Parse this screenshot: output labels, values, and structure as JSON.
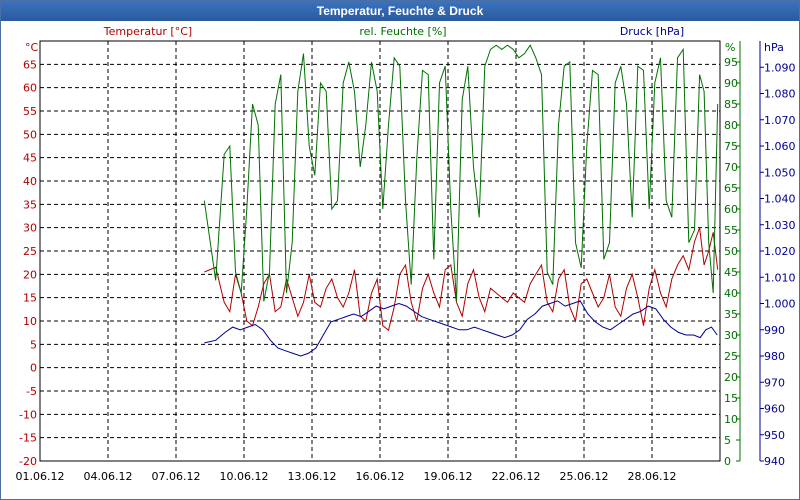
{
  "window": {
    "title": "Temperatur, Feuchte & Druck"
  },
  "chart_data": {
    "type": "line",
    "x_ticks": [
      "01.06.12",
      "04.06.12",
      "07.06.12",
      "10.06.12",
      "13.06.12",
      "16.06.12",
      "19.06.12",
      "22.06.12",
      "25.06.12",
      "28.06.12"
    ],
    "xlim": [
      "01.06.12",
      "01.07.12"
    ],
    "grid": true,
    "axes": {
      "temperature": {
        "label": "Temperatur [°C]",
        "unit": "°C",
        "ylim": [
          -20,
          70
        ],
        "ticks": [
          -20,
          -15,
          -10,
          -5,
          0,
          5,
          10,
          15,
          20,
          25,
          30,
          35,
          40,
          45,
          50,
          55,
          60,
          65
        ],
        "color": "#b00000"
      },
      "humidity": {
        "label": "rel. Feuchte [%]",
        "unit": "%",
        "ylim": [
          0,
          100
        ],
        "ticks": [
          0,
          5,
          10,
          15,
          20,
          25,
          30,
          35,
          40,
          45,
          50,
          55,
          60,
          65,
          70,
          75,
          80,
          85,
          90,
          95
        ],
        "color": "#007000"
      },
      "pressure": {
        "label": "Druck [hPa]",
        "unit": "hPa",
        "ylim": [
          940,
          1100
        ],
        "ticks": [
          "940",
          "950",
          "960",
          "970",
          "980",
          "990",
          "1.000",
          "1.010",
          "1.020",
          "1.030",
          "1.040",
          "1.050",
          "1.060",
          "1.070",
          "1.080",
          "1.090"
        ],
        "color": "#000090"
      }
    },
    "series": [
      {
        "name": "Temperatur [°C]",
        "axis": "temperature",
        "color": "#b00000",
        "x": [
          "08.06.12",
          "08.06.12",
          "09.06.12",
          "09.06.12",
          "09.06.12",
          "09.06.12",
          "10.06.12",
          "10.06.12",
          "10.06.12",
          "10.06.12",
          "11.06.12",
          "11.06.12",
          "11.06.12",
          "11.06.12",
          "12.06.12",
          "12.06.12",
          "12.06.12",
          "12.06.12",
          "13.06.12",
          "13.06.12",
          "13.06.12",
          "13.06.12",
          "14.06.12",
          "14.06.12",
          "14.06.12",
          "14.06.12",
          "15.06.12",
          "15.06.12",
          "15.06.12",
          "15.06.12",
          "16.06.12",
          "16.06.12",
          "16.06.12",
          "16.06.12",
          "17.06.12",
          "17.06.12",
          "17.06.12",
          "17.06.12",
          "18.06.12",
          "18.06.12",
          "18.06.12",
          "18.06.12",
          "19.06.12",
          "19.06.12",
          "19.06.12",
          "19.06.12",
          "20.06.12",
          "20.06.12",
          "20.06.12",
          "20.06.12",
          "21.06.12",
          "21.06.12",
          "21.06.12",
          "21.06.12",
          "22.06.12",
          "22.06.12",
          "22.06.12",
          "22.06.12",
          "23.06.12",
          "23.06.12",
          "23.06.12",
          "23.06.12",
          "24.06.12",
          "24.06.12",
          "24.06.12",
          "24.06.12",
          "25.06.12",
          "25.06.12",
          "25.06.12",
          "25.06.12",
          "26.06.12",
          "26.06.12",
          "26.06.12",
          "26.06.12",
          "27.06.12",
          "27.06.12",
          "27.06.12",
          "27.06.12",
          "28.06.12",
          "28.06.12",
          "28.06.12",
          "28.06.12",
          "29.06.12",
          "29.06.12",
          "29.06.12",
          "29.06.12",
          "30.06.12",
          "30.06.12",
          "30.06.12",
          "30.06.12",
          "30.06.12"
        ],
        "y": [
          20.5,
          21.5,
          14,
          12,
          20,
          16,
          10,
          9,
          13,
          18,
          20,
          12,
          13,
          19,
          15,
          11,
          14,
          20,
          14,
          13,
          17,
          19,
          15,
          13,
          16,
          21,
          11,
          10,
          16,
          19,
          9,
          8,
          13,
          20,
          22,
          14,
          10,
          17,
          20,
          16,
          13,
          21,
          22,
          14,
          11,
          18,
          21,
          15,
          12,
          17,
          16,
          15,
          14,
          16,
          15,
          14,
          18,
          20,
          22,
          14,
          12,
          19,
          21,
          13,
          10,
          18,
          19,
          16,
          13,
          15,
          20,
          13,
          11,
          17,
          20,
          15,
          9,
          17,
          21,
          16,
          13,
          19,
          22,
          24,
          21,
          27,
          30,
          22,
          25,
          29,
          21
        ]
      },
      {
        "name": "rel. Feuchte [%]",
        "axis": "humidity",
        "color": "#007000",
        "x": [
          "08.06.12",
          "08.06.12",
          "09.06.12",
          "09.06.12",
          "09.06.12",
          "09.06.12",
          "10.06.12",
          "10.06.12",
          "10.06.12",
          "10.06.12",
          "11.06.12",
          "11.06.12",
          "11.06.12",
          "11.06.12",
          "12.06.12",
          "12.06.12",
          "12.06.12",
          "12.06.12",
          "13.06.12",
          "13.06.12",
          "13.06.12",
          "13.06.12",
          "14.06.12",
          "14.06.12",
          "14.06.12",
          "14.06.12",
          "15.06.12",
          "15.06.12",
          "15.06.12",
          "15.06.12",
          "16.06.12",
          "16.06.12",
          "16.06.12",
          "16.06.12",
          "17.06.12",
          "17.06.12",
          "17.06.12",
          "17.06.12",
          "18.06.12",
          "18.06.12",
          "18.06.12",
          "18.06.12",
          "19.06.12",
          "19.06.12",
          "19.06.12",
          "19.06.12",
          "20.06.12",
          "20.06.12",
          "20.06.12",
          "20.06.12",
          "21.06.12",
          "21.06.12",
          "21.06.12",
          "21.06.12",
          "22.06.12",
          "22.06.12",
          "22.06.12",
          "22.06.12",
          "23.06.12",
          "23.06.12",
          "23.06.12",
          "23.06.12",
          "24.06.12",
          "24.06.12",
          "24.06.12",
          "24.06.12",
          "25.06.12",
          "25.06.12",
          "25.06.12",
          "25.06.12",
          "26.06.12",
          "26.06.12",
          "26.06.12",
          "26.06.12",
          "27.06.12",
          "27.06.12",
          "27.06.12",
          "27.06.12",
          "28.06.12",
          "28.06.12",
          "28.06.12",
          "28.06.12",
          "29.06.12",
          "29.06.12",
          "29.06.12",
          "29.06.12",
          "30.06.12",
          "30.06.12",
          "30.06.12",
          "30.06.12",
          "30.06.12"
        ],
        "y": [
          62,
          43,
          73,
          75,
          45,
          40,
          60,
          85,
          80,
          38,
          45,
          85,
          92,
          40,
          52,
          88,
          97,
          75,
          68,
          90,
          88,
          60,
          62,
          90,
          95,
          88,
          70,
          80,
          95,
          88,
          60,
          80,
          96,
          94,
          62,
          42,
          72,
          93,
          92,
          48,
          90,
          94,
          60,
          38,
          86,
          94,
          70,
          58,
          94,
          98,
          99,
          98,
          99,
          98,
          96,
          97,
          99,
          96,
          92,
          45,
          42,
          80,
          94,
          95,
          52,
          46,
          75,
          93,
          92,
          48,
          52,
          90,
          94,
          85,
          58,
          94,
          93,
          60,
          90,
          96,
          62,
          58,
          96,
          98,
          52,
          55,
          92,
          88,
          52,
          40,
          85
        ]
      },
      {
        "name": "Druck [hPa]",
        "axis": "pressure",
        "color": "#000090",
        "x": [
          "08.06.12",
          "08.06.12",
          "09.06.12",
          "09.06.12",
          "09.06.12",
          "10.06.12",
          "10.06.12",
          "10.06.12",
          "11.06.12",
          "11.06.12",
          "11.06.12",
          "12.06.12",
          "12.06.12",
          "12.06.12",
          "13.06.12",
          "13.06.12",
          "13.06.12",
          "14.06.12",
          "14.06.12",
          "14.06.12",
          "15.06.12",
          "15.06.12",
          "15.06.12",
          "16.06.12",
          "16.06.12",
          "16.06.12",
          "17.06.12",
          "17.06.12",
          "17.06.12",
          "18.06.12",
          "18.06.12",
          "18.06.12",
          "19.06.12",
          "19.06.12",
          "19.06.12",
          "20.06.12",
          "20.06.12",
          "20.06.12",
          "21.06.12",
          "21.06.12",
          "21.06.12",
          "22.06.12",
          "22.06.12",
          "22.06.12",
          "23.06.12",
          "23.06.12",
          "23.06.12",
          "24.06.12",
          "24.06.12",
          "24.06.12",
          "25.06.12",
          "25.06.12",
          "25.06.12",
          "26.06.12",
          "26.06.12",
          "26.06.12",
          "27.06.12",
          "27.06.12",
          "27.06.12",
          "28.06.12",
          "28.06.12",
          "28.06.12",
          "29.06.12",
          "29.06.12",
          "29.06.12",
          "30.06.12",
          "30.06.12",
          "30.06.12",
          "30.06.12"
        ],
        "y": [
          985,
          986,
          989,
          991,
          990,
          991,
          992,
          990,
          986,
          983,
          982,
          981,
          980,
          981,
          983,
          988,
          993,
          994,
          995,
          996,
          995,
          997,
          999,
          998,
          999,
          1000,
          999,
          997,
          995,
          994,
          993,
          992,
          991,
          990,
          990,
          991,
          990,
          989,
          988,
          987,
          988,
          990,
          994,
          996,
          999,
          1000,
          1001,
          999,
          1000,
          1001,
          996,
          993,
          991,
          990,
          992,
          994,
          996,
          997,
          999,
          998,
          994,
          991,
          989,
          988,
          988,
          987,
          990,
          991,
          988
        ]
      }
    ]
  }
}
